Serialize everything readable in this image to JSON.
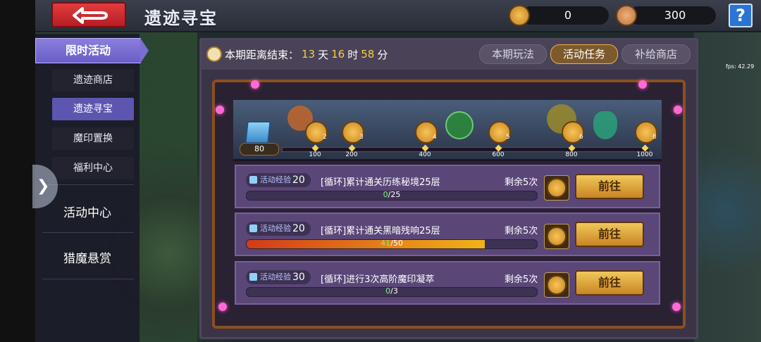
{
  "header": {
    "title": "遗迹寻宝",
    "currency1_value": "0",
    "currency2_value": "300",
    "help_label": "?"
  },
  "fps": "fps: 42.29",
  "sidebar": {
    "section_label": "限时活动",
    "sub_items": [
      {
        "label": "遗迹商店",
        "active": false
      },
      {
        "label": "遗迹寻宝",
        "active": true
      },
      {
        "label": "魔印置换",
        "active": false
      },
      {
        "label": "福利中心",
        "active": false
      }
    ],
    "main_items": [
      {
        "label": "活动中心"
      },
      {
        "label": "猎魔悬赏"
      }
    ]
  },
  "countdown": {
    "label": "本期距离结束：",
    "days": "13",
    "days_unit": "天",
    "hours": "16",
    "hours_unit": "时",
    "minutes": "58",
    "minutes_unit": "分"
  },
  "tabs": [
    {
      "label": "本期玩法",
      "active": false
    },
    {
      "label": "活动任务",
      "active": true
    },
    {
      "label": "补给商店",
      "active": false
    }
  ],
  "progress_track": {
    "current_exp": "80",
    "milestones": [
      {
        "index": "2",
        "value": "100"
      },
      {
        "index": "3",
        "value": "200"
      },
      {
        "index": "4",
        "value": "400"
      },
      {
        "index": "5",
        "value": "600"
      },
      {
        "index": "6",
        "value": "800"
      },
      {
        "index": "8",
        "value": "1000"
      }
    ]
  },
  "tasks": [
    {
      "exp_label": "活动经验",
      "exp": "20",
      "title": "[循环]累计通关历练秘境25层",
      "remaining": "剩余5次",
      "progress_current": "0",
      "progress_total": "/25",
      "progress_fraction": 0,
      "button": "前往"
    },
    {
      "exp_label": "活动经验",
      "exp": "20",
      "title": "[循环]累计通关黑暗残响25层",
      "remaining": "剩余5次",
      "progress_current": "41",
      "progress_total": "/50",
      "progress_fraction": 0.82,
      "button": "前往"
    },
    {
      "exp_label": "活动经验",
      "exp": "30",
      "title": "[循环]进行3次高阶魔印凝萃",
      "remaining": "剩余5次",
      "progress_current": "0",
      "progress_total": "/3",
      "progress_fraction": 0,
      "button": "前往"
    }
  ],
  "colors": {
    "accent_gold": "#f7cd47",
    "tab_active": "#7d5a2c",
    "menu_active": "#5c56b0",
    "back_button": "#e23c3c"
  }
}
